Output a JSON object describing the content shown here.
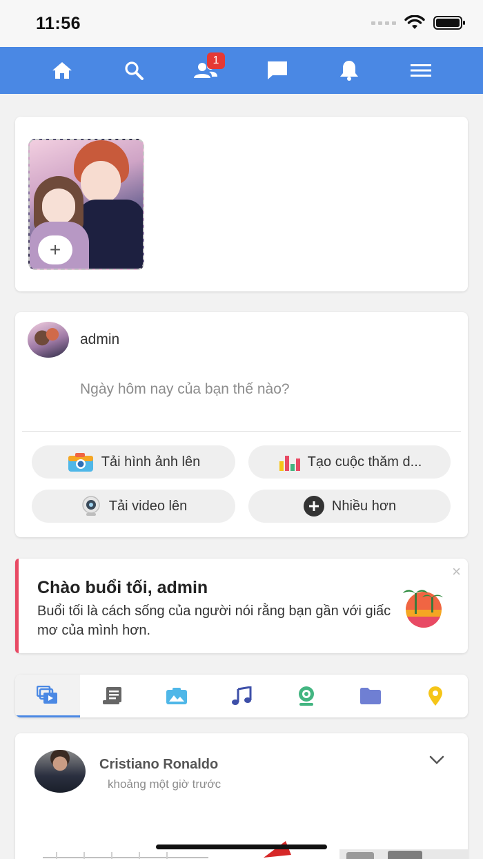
{
  "status_bar": {
    "time": "11:56"
  },
  "nav": {
    "items": [
      {
        "icon": "home-icon"
      },
      {
        "icon": "search-icon"
      },
      {
        "icon": "friends-icon",
        "badge": "1"
      },
      {
        "icon": "messages-icon"
      },
      {
        "icon": "bell-icon"
      },
      {
        "icon": "menu-icon"
      }
    ],
    "color": "#4a88e4"
  },
  "stories": {
    "add_symbol": "+"
  },
  "composer": {
    "username": "admin",
    "placeholder": "Ngày hôm nay của bạn thế nào?",
    "actions": {
      "upload_photo": "Tải hình ảnh lên",
      "create_poll": "Tạo cuộc thăm d...",
      "upload_video": "Tải video lên",
      "more": "Nhiều hơn"
    }
  },
  "greeting": {
    "title": "Chào buổi tối, admin",
    "text": "Buổi tối là cách sống của người nói rằng bạn gần với giấc mơ của mình hơn.",
    "close": "×",
    "accent_color": "#e84a64"
  },
  "tabs": [
    {
      "icon": "feed-icon"
    },
    {
      "icon": "article-icon"
    },
    {
      "icon": "photo-icon"
    },
    {
      "icon": "music-icon"
    },
    {
      "icon": "webcam-icon"
    },
    {
      "icon": "folder-icon"
    },
    {
      "icon": "location-icon"
    }
  ],
  "post": {
    "author": "Cristiano Ronaldo",
    "time": "khoảng một giờ trước"
  }
}
